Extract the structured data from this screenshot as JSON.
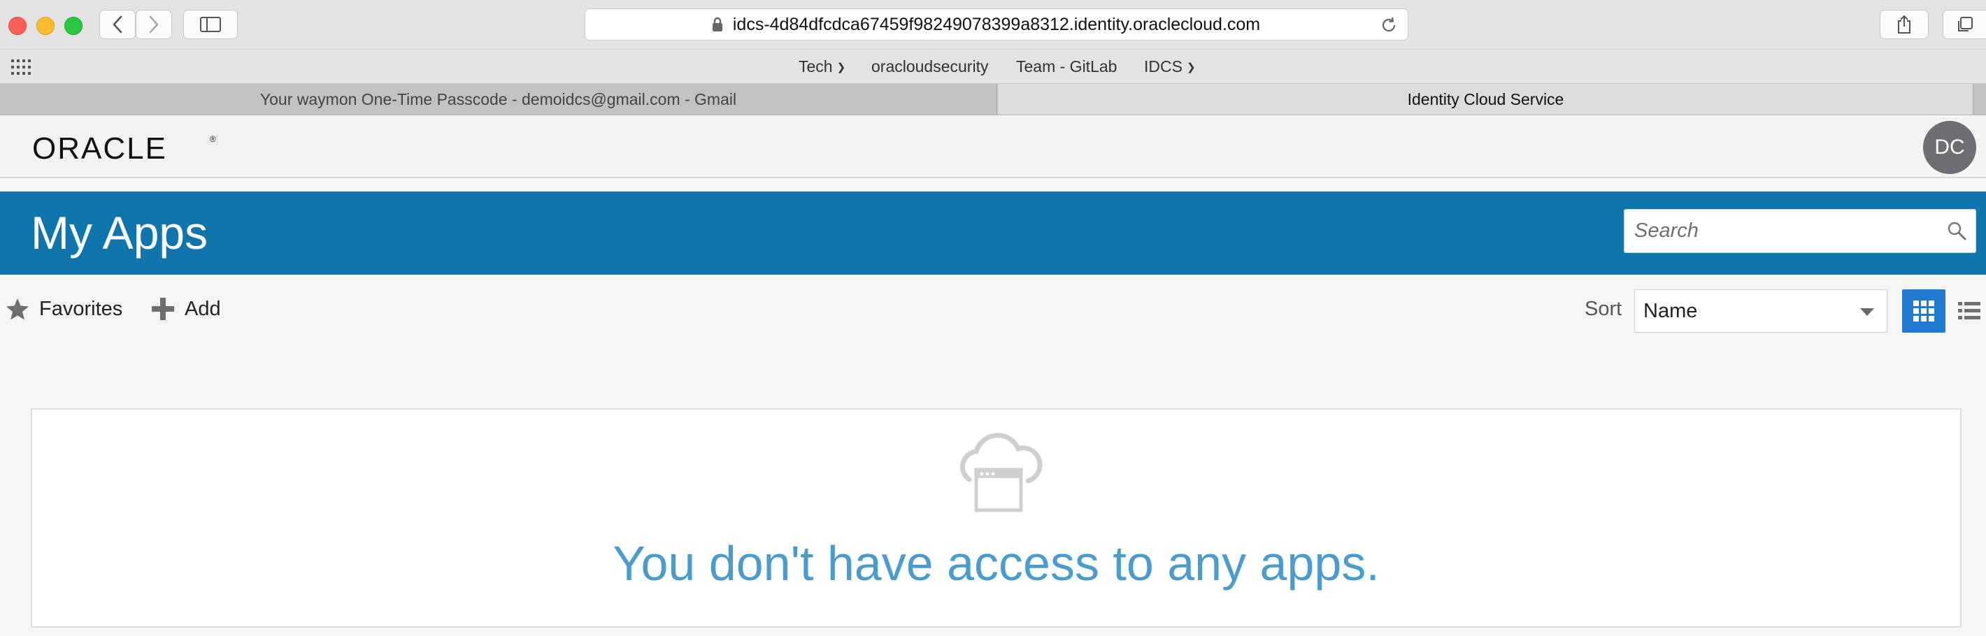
{
  "browser": {
    "url": "idcs-4d84dfcdca67459f98249078399a8312.identity.oraclecloud.com",
    "bookmarks": [
      {
        "label": "Tech",
        "has_menu": true
      },
      {
        "label": "oracloudsecurity",
        "has_menu": false
      },
      {
        "label": "Team - GitLab",
        "has_menu": false
      },
      {
        "label": "IDCS",
        "has_menu": true
      }
    ],
    "tabs": [
      {
        "title": "Your waymon One-Time Passcode - demoidcs@gmail.com - Gmail",
        "active": false
      },
      {
        "title": "Identity Cloud Service",
        "active": true
      }
    ]
  },
  "header": {
    "logo": "ORACLE",
    "logo_mark": "®",
    "user_initials": "DC"
  },
  "banner": {
    "title": "My Apps",
    "search_placeholder": "Search"
  },
  "toolbar": {
    "favorites_label": "Favorites",
    "add_label": "Add",
    "sort_label": "Sort",
    "sort_value": "Name"
  },
  "empty_state": {
    "message": "You don't have access to any apps."
  },
  "colors": {
    "banner": "#1075ac",
    "accent": "#1f7ad2",
    "empty_text": "#4a9bce"
  },
  "icons": [
    "star-icon",
    "plus-icon",
    "search-icon",
    "grid-view-icon",
    "list-view-icon",
    "cloud-app-icon",
    "lock-icon",
    "reload-icon",
    "share-icon",
    "tabs-icon",
    "sidebar-icon",
    "back-icon",
    "forward-icon",
    "apps-grid-icon"
  ]
}
